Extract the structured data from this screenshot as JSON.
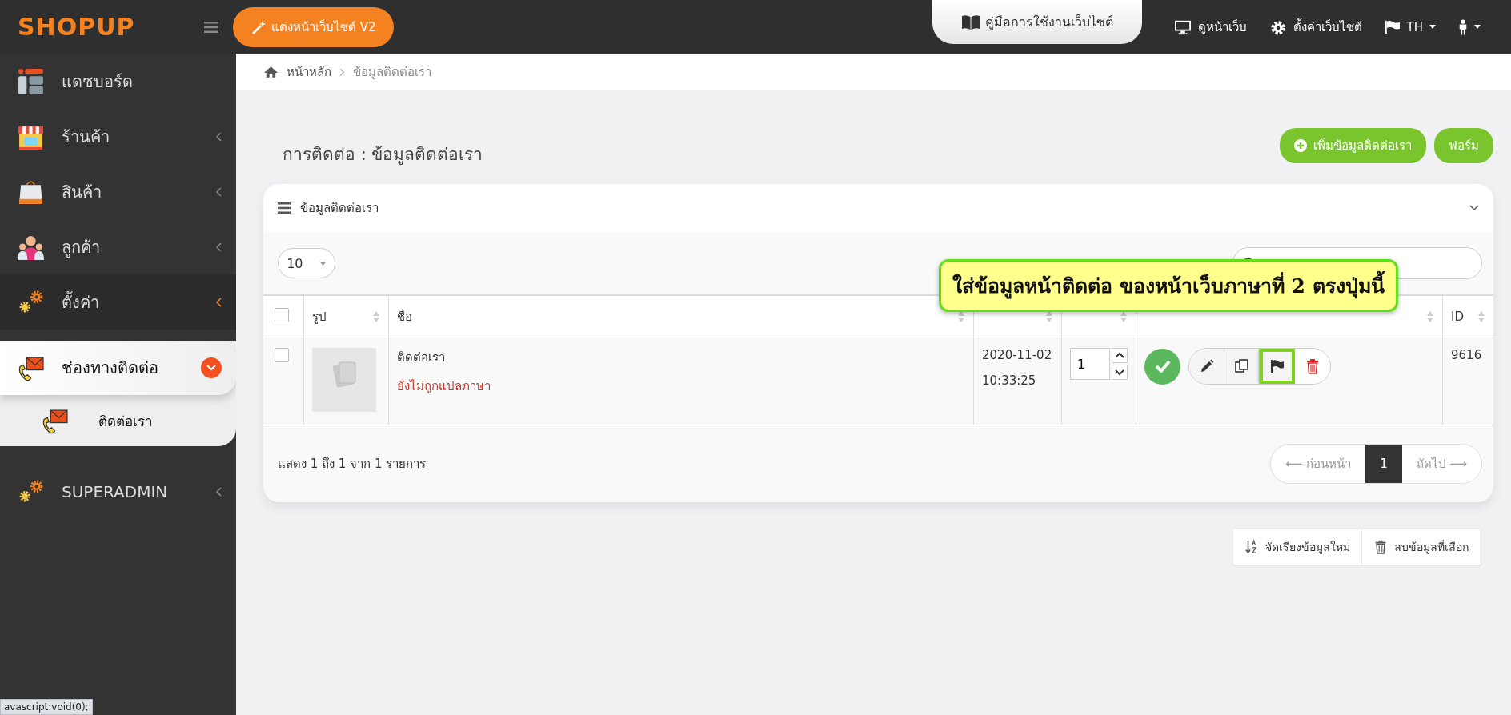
{
  "topbar": {
    "logo": "SHOPUP",
    "design_button": "แต่งหน้าเว็บไซต์ V2",
    "manual_tab": "คู่มือการใช้งานเว็บไซต์",
    "links": [
      "ดูหน้าเว็บ",
      "ตั้งค่าเว็บไซต์"
    ],
    "language": "TH"
  },
  "sidebar": {
    "items": [
      {
        "label": "แดชบอร์ด",
        "expandable": false,
        "active": false,
        "selected": false
      },
      {
        "label": "ร้านค้า",
        "expandable": true,
        "active": false,
        "selected": false
      },
      {
        "label": "สินค้า",
        "expandable": true,
        "active": false,
        "selected": false
      },
      {
        "label": "ลูกค้า",
        "expandable": true,
        "active": false,
        "selected": false
      },
      {
        "label": "ตั้งค่า",
        "expandable": true,
        "active": true,
        "selected": false
      },
      {
        "label": "ช่องทางติดต่อ",
        "expandable": true,
        "active": false,
        "selected": true,
        "expanded": true,
        "children": [
          {
            "label": "ติดต่อเรา"
          }
        ]
      },
      {
        "label": "SUPERADMIN",
        "expandable": true,
        "active": false,
        "selected": false
      }
    ]
  },
  "breadcrumb": [
    "หน้าหลัก",
    "ข้อมูลติดต่อเรา"
  ],
  "page_title": "การติดต่อ : ข้อมูลติดต่อเรา",
  "header_buttons": [
    "เพิ่มข้อมูลติดต่อเรา",
    "ฟอร์ม"
  ],
  "card": {
    "title": "ข้อมูลติดต่อเรา",
    "page_size": "10",
    "table": {
      "select_all": false,
      "columns": [
        {
          "label": "รูป"
        },
        {
          "label": "ชื่อ"
        },
        {},
        {},
        {},
        {
          "label": "ID"
        }
      ],
      "rows": [
        {
          "checked": false,
          "name": "ติดต่อเรา",
          "status": "ยังไม่ถูกแปลภาษา",
          "date": "2020-11-02",
          "time": "10:33:25",
          "order": "1",
          "enabled": true,
          "id": "9616"
        }
      ]
    },
    "info": "แสดง 1 ถึง 1 จาก 1 รายการ",
    "pagination": {
      "previous": "⟵ ก่อนหน้า",
      "pages": [
        {
          "label": "1",
          "selected": true
        }
      ],
      "next": "ถัดไป ⟶"
    }
  },
  "annotation": {
    "text": "ใส่ข้อมูลหน้าติดต่อ ของหน้าเว็บภาษาที่ 2 ตรงปุ่มนี้",
    "highlight_translate_button": true
  },
  "bottom_buttons": [
    "จัดเรียงข้อมูลใหม่",
    "ลบข้อมูลที่เลือก"
  ],
  "status_bar": "avascript:void(0);"
}
